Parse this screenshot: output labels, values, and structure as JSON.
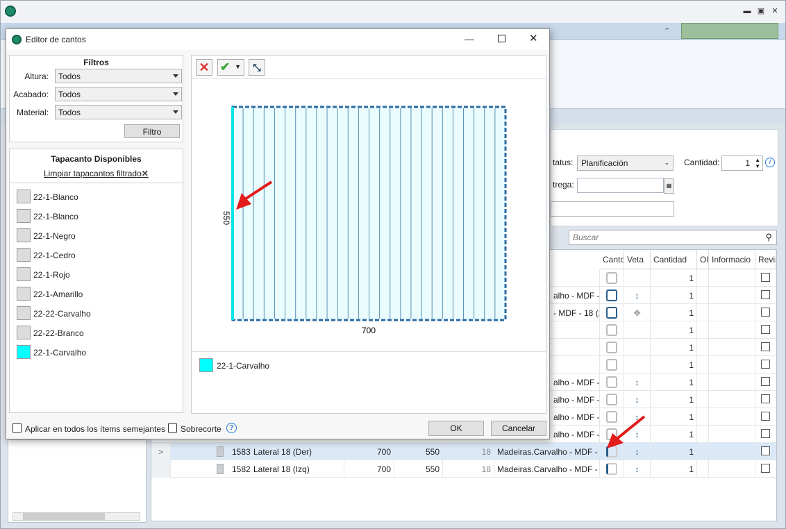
{
  "background_form": {
    "status_label": "tatus:",
    "status_value": "Planificación",
    "cantidad_label": "Cantidad:",
    "cantidad_value": "1",
    "entrega_label": "trega:",
    "search_placeholder": "Buscar"
  },
  "grid": {
    "headers": [
      "Canto",
      "Veta",
      "Cantidad",
      "Ol",
      "Informacio",
      "Revis"
    ],
    "upper_rows": [
      {
        "material": "",
        "cantidad": "1"
      },
      {
        "material": "alho - MDF -",
        "cantidad": "1"
      },
      {
        "material": "- MDF - 18 (2",
        "cantidad": "1"
      },
      {
        "material": "",
        "cantidad": "1"
      },
      {
        "material": "",
        "cantidad": "1"
      },
      {
        "material": "",
        "cantidad": "1"
      },
      {
        "material": "alho - MDF -",
        "cantidad": "1"
      },
      {
        "material": "alho - MDF -",
        "cantidad": "1"
      },
      {
        "material": "alho - MDF -",
        "cantidad": "1"
      },
      {
        "material": "alho - MDF -",
        "cantidad": "1"
      }
    ],
    "bottom_rows": [
      {
        "expander": ">",
        "id": "1583",
        "name": "Lateral 18 (Der)",
        "length": "700",
        "width": "550",
        "thickness": "18",
        "material": "Madeiras.Carvalho - MDF -",
        "cantidad": "1"
      },
      {
        "expander": "",
        "id": "1582",
        "name": "Lateral 18 (Izq)",
        "length": "700",
        "width": "550",
        "thickness": "18",
        "material": "Madeiras.Carvalho - MDF -",
        "cantidad": "1"
      }
    ]
  },
  "dialog": {
    "title": "Editor de cantos",
    "filters": {
      "title": "Filtros",
      "altura_label": "Altura:",
      "altura_value": "Todos",
      "acabado_label": "Acabado:",
      "acabado_value": "Todos",
      "material_label": "Material:",
      "material_value": "Todos",
      "filter_button": "Filtro"
    },
    "available": {
      "title": "Tapacanto Disponibles",
      "clear_label": "Limpiar tapacantos filtrado",
      "items": [
        {
          "label": "22-1-Blanco",
          "color": "#dcdcdc"
        },
        {
          "label": "22-1-Blanco",
          "color": "#dcdcdc"
        },
        {
          "label": "22-1-Negro",
          "color": "#dcdcdc"
        },
        {
          "label": "22-1-Cedro",
          "color": "#dcdcdc"
        },
        {
          "label": "22-1-Rojo",
          "color": "#dcdcdc"
        },
        {
          "label": "22-1-Amarillo",
          "color": "#dcdcdc"
        },
        {
          "label": "22-22-Carvalho",
          "color": "#dcdcdc"
        },
        {
          "label": "22-22-Branco",
          "color": "#dcdcdc"
        },
        {
          "label": "22-1-Carvalho",
          "color": "#00ffff"
        }
      ]
    },
    "preview": {
      "height_label": "550",
      "width_label": "700",
      "legend_label": "22-1-Carvalho",
      "legend_color": "#00ffff"
    },
    "footer": {
      "apply_all_label": "Aplicar en todos los ítems semejantes",
      "sobrecorte_label": "Sobrecorte",
      "ok_label": "OK",
      "cancel_label": "Cancelar"
    }
  }
}
